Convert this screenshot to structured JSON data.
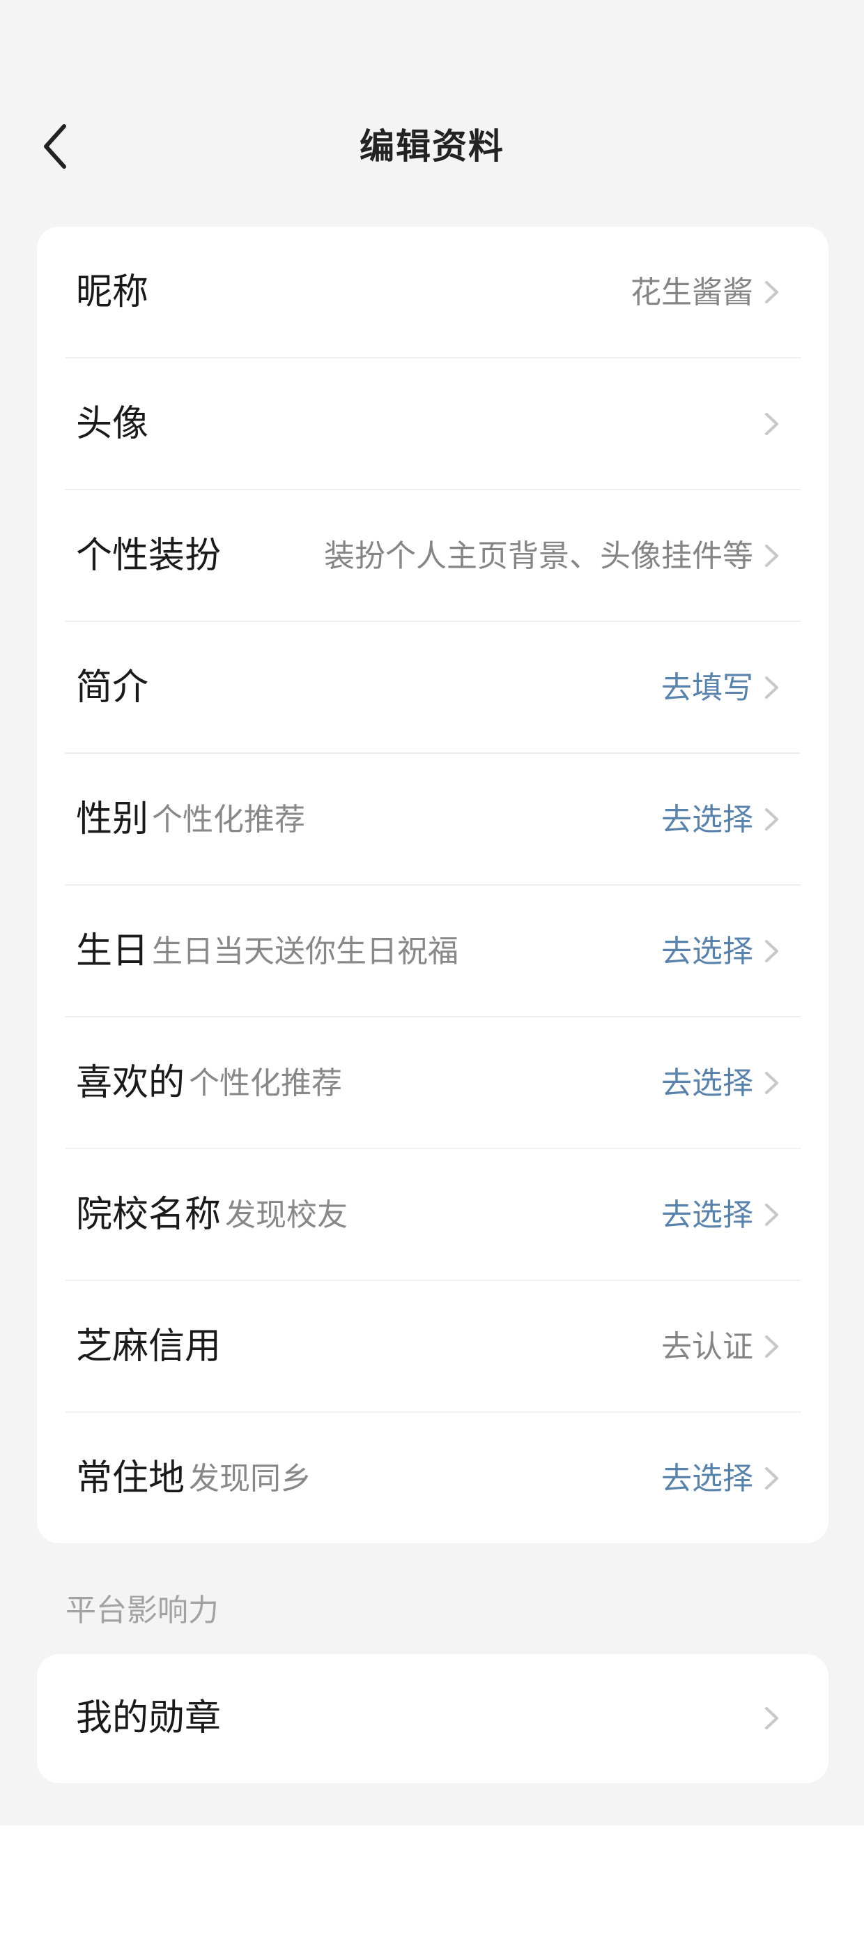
{
  "header": {
    "title": "编辑资料"
  },
  "profile_rows": [
    {
      "label": "昵称",
      "hint": "",
      "value": "花生酱酱",
      "value_style": "gray"
    },
    {
      "label": "头像",
      "hint": "",
      "value": "",
      "value_style": "gray"
    },
    {
      "label": "个性装扮",
      "hint": "",
      "value": "装扮个人主页背景、头像挂件等",
      "value_style": "gray"
    },
    {
      "label": "简介",
      "hint": "",
      "value": "去填写",
      "value_style": "blue"
    },
    {
      "label": "性别",
      "hint": "个性化推荐",
      "value": "去选择",
      "value_style": "blue"
    },
    {
      "label": "生日",
      "hint": "生日当天送你生日祝福",
      "value": "去选择",
      "value_style": "blue"
    },
    {
      "label": "喜欢的",
      "hint": "个性化推荐",
      "value": "去选择",
      "value_style": "blue"
    },
    {
      "label": "院校名称",
      "hint": "发现校友",
      "value": "去选择",
      "value_style": "blue"
    },
    {
      "label": "芝麻信用",
      "hint": "",
      "value": "去认证",
      "value_style": "gray"
    },
    {
      "label": "常住地",
      "hint": "发现同乡",
      "value": "去选择",
      "value_style": "blue"
    }
  ],
  "influence_section": {
    "title": "平台影响力",
    "rows": [
      {
        "label": "我的勋章"
      }
    ]
  },
  "colors": {
    "background": "#f4f4f4",
    "card": "#ffffff",
    "accent_blue": "#5a83ac",
    "value_gray": "#858585",
    "hint_gray": "#888888",
    "chevron": "#c8c8c8"
  },
  "icons": {
    "back": "chevron-left-icon",
    "row_arrow": "chevron-right-icon"
  }
}
